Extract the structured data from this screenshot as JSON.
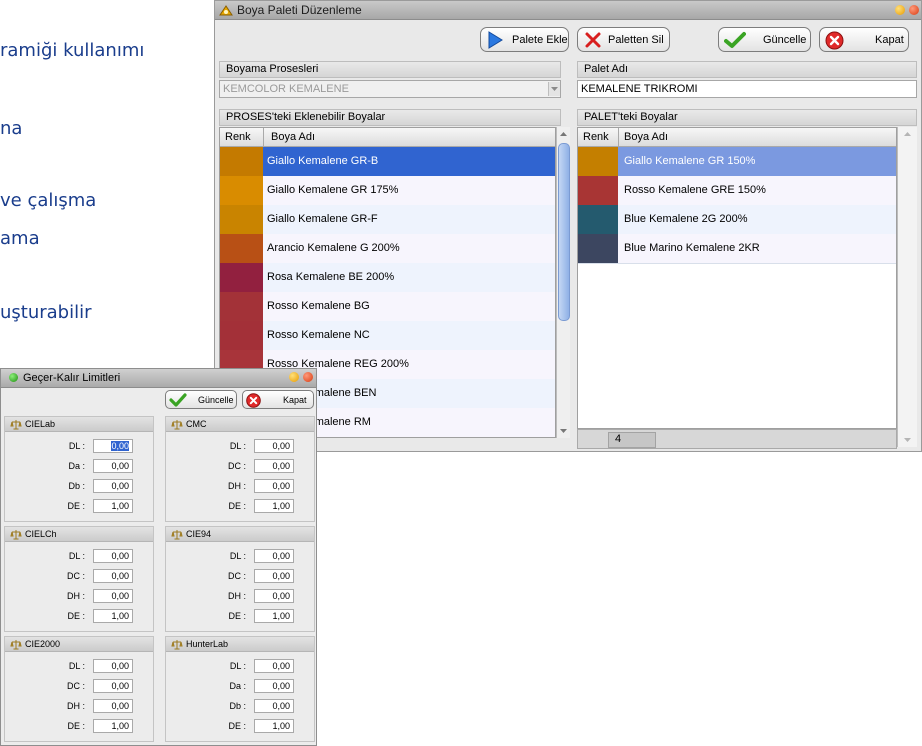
{
  "background_text": [
    {
      "text": "ramiği kullanımı"
    },
    {
      "text": "na"
    },
    {
      "text": "ve çalışma"
    },
    {
      "text": "ama"
    },
    {
      "text": "uşturabilir"
    }
  ],
  "main_window": {
    "title": "Boya Paleti Düzenleme",
    "toolbar": {
      "add_label": "Palete Ekle",
      "remove_label": "Paletten Sil",
      "update_label": "Güncelle",
      "close_label": "Kapat"
    },
    "process_section": {
      "label": "Boyama Prosesleri",
      "value": "KEMCOLOR KEMALENE"
    },
    "palette_section": {
      "label": "Palet Adı",
      "value": "KEMALENE TRIKROMI"
    },
    "left_list": {
      "label": "PROSES'teki Eklenebilir Boyalar",
      "col_color": "Renk",
      "col_name": "Boya Adı",
      "rows": [
        {
          "name": "Giallo Kemalene GR-B",
          "color": "#c47a00",
          "selected": true
        },
        {
          "name": "Giallo Kemalene GR 175%",
          "color": "#d98c00"
        },
        {
          "name": "Giallo Kemalene GR-F",
          "color": "#c98400"
        },
        {
          "name": "Arancio Kemalene G 200%",
          "color": "#b85015"
        },
        {
          "name": "Rosa Kemalene BE 200%",
          "color": "#92203f"
        },
        {
          "name": "Rosso Kemalene BG",
          "color": "#a33238"
        },
        {
          "name": "Rosso Kemalene NC",
          "color": "#a33038"
        },
        {
          "name": "Rosso Kemalene REG 200%",
          "color": "#a8343a"
        },
        {
          "name": "Rosso Kemalene BEN",
          "color": "#9c2e38"
        },
        {
          "name": "Rosso Kemalene RM",
          "color": "#9c3036"
        }
      ]
    },
    "right_list": {
      "label": "PALET'teki Boyalar",
      "col_color": "Renk",
      "col_name": "Boya Adı",
      "rows": [
        {
          "name": "Giallo Kemalene GR 150%",
          "color": "#c47f00",
          "selected": true
        },
        {
          "name": "Rosso Kemalene GRE 150%",
          "color": "#a83534"
        },
        {
          "name": "Blue Kemalene 2G 200%",
          "color": "#245a6e"
        },
        {
          "name": "Blue Marino Kemalene 2KR",
          "color": "#3c4660"
        }
      ],
      "count": "4"
    }
  },
  "limits_window": {
    "title": "Geçer-Kalır Limitleri",
    "update_label": "Güncelle",
    "close_label": "Kapat",
    "groups": [
      {
        "name": "CIELab",
        "fields": [
          {
            "label": "DL :",
            "value": "0,00"
          },
          {
            "label": "Da :",
            "value": "0,00"
          },
          {
            "label": "Db :",
            "value": "0,00"
          },
          {
            "label": "DE :",
            "value": "1,00"
          }
        ]
      },
      {
        "name": "CMC",
        "fields": [
          {
            "label": "DL :",
            "value": "0,00"
          },
          {
            "label": "DC :",
            "value": "0,00"
          },
          {
            "label": "DH :",
            "value": "0,00"
          },
          {
            "label": "DE :",
            "value": "1,00"
          }
        ]
      },
      {
        "name": "CIELCh",
        "fields": [
          {
            "label": "DL :",
            "value": "0,00"
          },
          {
            "label": "DC :",
            "value": "0,00"
          },
          {
            "label": "DH :",
            "value": "0,00"
          },
          {
            "label": "DE :",
            "value": "1,00"
          }
        ]
      },
      {
        "name": "CIE94",
        "fields": [
          {
            "label": "DL :",
            "value": "0,00"
          },
          {
            "label": "DC :",
            "value": "0,00"
          },
          {
            "label": "DH :",
            "value": "0,00"
          },
          {
            "label": "DE :",
            "value": "1,00"
          }
        ]
      },
      {
        "name": "CIE2000",
        "fields": [
          {
            "label": "DL :",
            "value": "0,00"
          },
          {
            "label": "DC :",
            "value": "0,00"
          },
          {
            "label": "DH :",
            "value": "0,00"
          },
          {
            "label": "DE :",
            "value": "1,00"
          }
        ]
      },
      {
        "name": "HunterLab",
        "fields": [
          {
            "label": "DL :",
            "value": "0,00"
          },
          {
            "label": "Da :",
            "value": "0,00"
          },
          {
            "label": "Db :",
            "value": "0,00"
          },
          {
            "label": "DE :",
            "value": "1,00"
          }
        ]
      }
    ]
  },
  "colors": {
    "selection": "#3064d0",
    "selection_right": "#7b99e0",
    "row_alt_a": "#eef3fd",
    "row_alt_b": "#f7f5fd",
    "scroll_thumb": "#a8c4ee"
  }
}
